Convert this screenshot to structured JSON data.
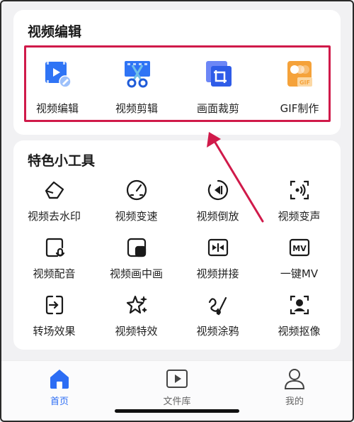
{
  "video_edit": {
    "title": "视频编辑",
    "items": [
      {
        "label": "视频编辑",
        "icon": "video-edit-icon"
      },
      {
        "label": "视频剪辑",
        "icon": "video-cut-icon"
      },
      {
        "label": "画面裁剪",
        "icon": "crop-icon"
      },
      {
        "label": "GIF制作",
        "icon": "gif-icon"
      }
    ]
  },
  "tools": {
    "title": "特色小工具",
    "items": [
      {
        "label": "视频去水印",
        "icon": "eraser-icon"
      },
      {
        "label": "视频变速",
        "icon": "speedometer-icon"
      },
      {
        "label": "视频倒放",
        "icon": "rewind-icon"
      },
      {
        "label": "视频变声",
        "icon": "voice-change-icon"
      },
      {
        "label": "视频配音",
        "icon": "dubbing-icon"
      },
      {
        "label": "视频画中画",
        "icon": "picture-in-picture-icon"
      },
      {
        "label": "视频拼接",
        "icon": "merge-icon"
      },
      {
        "label": "一键MV",
        "icon": "mv-icon"
      },
      {
        "label": "转场效果",
        "icon": "transition-icon"
      },
      {
        "label": "视频特效",
        "icon": "sparkle-icon"
      },
      {
        "label": "视频涂鸦",
        "icon": "brush-icon"
      },
      {
        "label": "视频抠像",
        "icon": "portrait-cutout-icon"
      }
    ]
  },
  "tabbar": {
    "tabs": [
      {
        "label": "首页",
        "icon": "home-icon",
        "active": true
      },
      {
        "label": "文件库",
        "icon": "video-library-icon",
        "active": false
      },
      {
        "label": "我的",
        "icon": "user-icon",
        "active": false
      }
    ]
  },
  "colors": {
    "accent": "#2c6df4",
    "highlight": "#d01a4a",
    "gif_orange": "#f5a23a"
  }
}
